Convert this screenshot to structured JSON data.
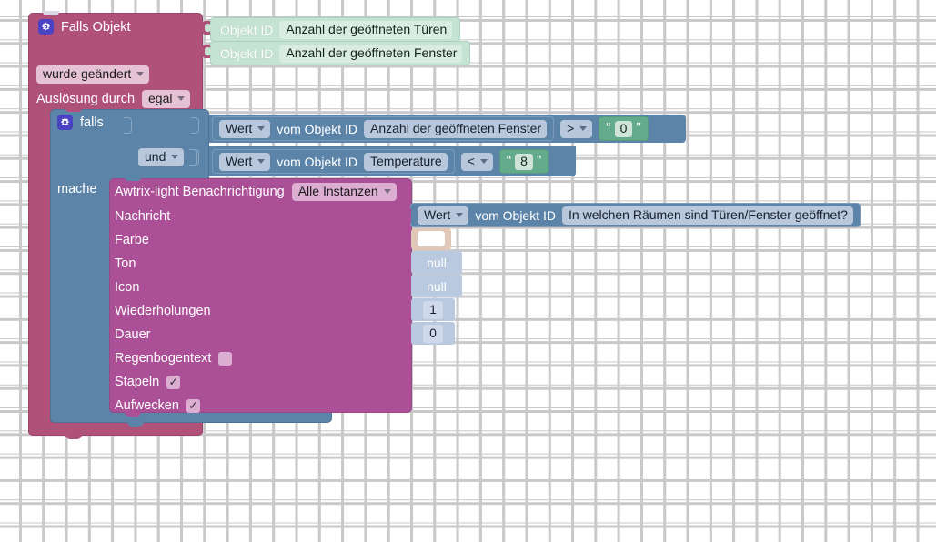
{
  "workspace": {
    "background": "#ffffff",
    "grid_color": "#c9c9c9"
  },
  "trigger_block": {
    "color": "#b0517a",
    "icon": "gear-icon",
    "title": "Falls Objekt",
    "object_ids": [
      {
        "label": "Objekt ID",
        "value": "Anzahl der geöffneten Türen"
      },
      {
        "label": "Objekt ID",
        "value": "Anzahl der geöffneten Fenster"
      }
    ],
    "condition_dropdown": "wurde geändert",
    "source_label": "Auslösung durch",
    "source_dropdown": "egal"
  },
  "if_block": {
    "color": "#5b84a8",
    "icon": "gear-icon",
    "title": "falls",
    "do_label": "mache",
    "join_operator": "und",
    "conditions": [
      {
        "value_dropdown": "Wert",
        "of_label": "vom Objekt ID",
        "object_id": "Anzahl der geöffneten Fenster",
        "operator": ">",
        "compare_value": "0"
      },
      {
        "value_dropdown": "Wert",
        "of_label": "vom Objekt ID",
        "object_id": "Temperature",
        "operator": "<",
        "compare_value": "8"
      }
    ]
  },
  "notification_block": {
    "color": "#ab4f97",
    "title": "Awtrix-light Benachrichtigung",
    "instance_dropdown": "Alle Instanzen",
    "fields": [
      {
        "label": "Nachricht",
        "type": "value-block"
      },
      {
        "label": "Farbe",
        "type": "colour",
        "value": "#ffffff"
      },
      {
        "label": "Ton",
        "type": "text",
        "value": "null"
      },
      {
        "label": "Icon",
        "type": "text",
        "value": "null"
      },
      {
        "label": "Wiederholungen",
        "type": "number",
        "value": "1"
      },
      {
        "label": "Dauer",
        "type": "number",
        "value": "0"
      },
      {
        "label": "Regenbogentext",
        "type": "checkbox",
        "checked": false
      },
      {
        "label": "Stapeln",
        "type": "checkbox",
        "checked": true
      },
      {
        "label": "Aufwecken",
        "type": "checkbox",
        "checked": true
      }
    ],
    "message_value": {
      "value_dropdown": "Wert",
      "of_label": "vom Objekt ID",
      "object_id": "In welchen Räumen sind Türen/Fenster geöffnet?"
    }
  }
}
